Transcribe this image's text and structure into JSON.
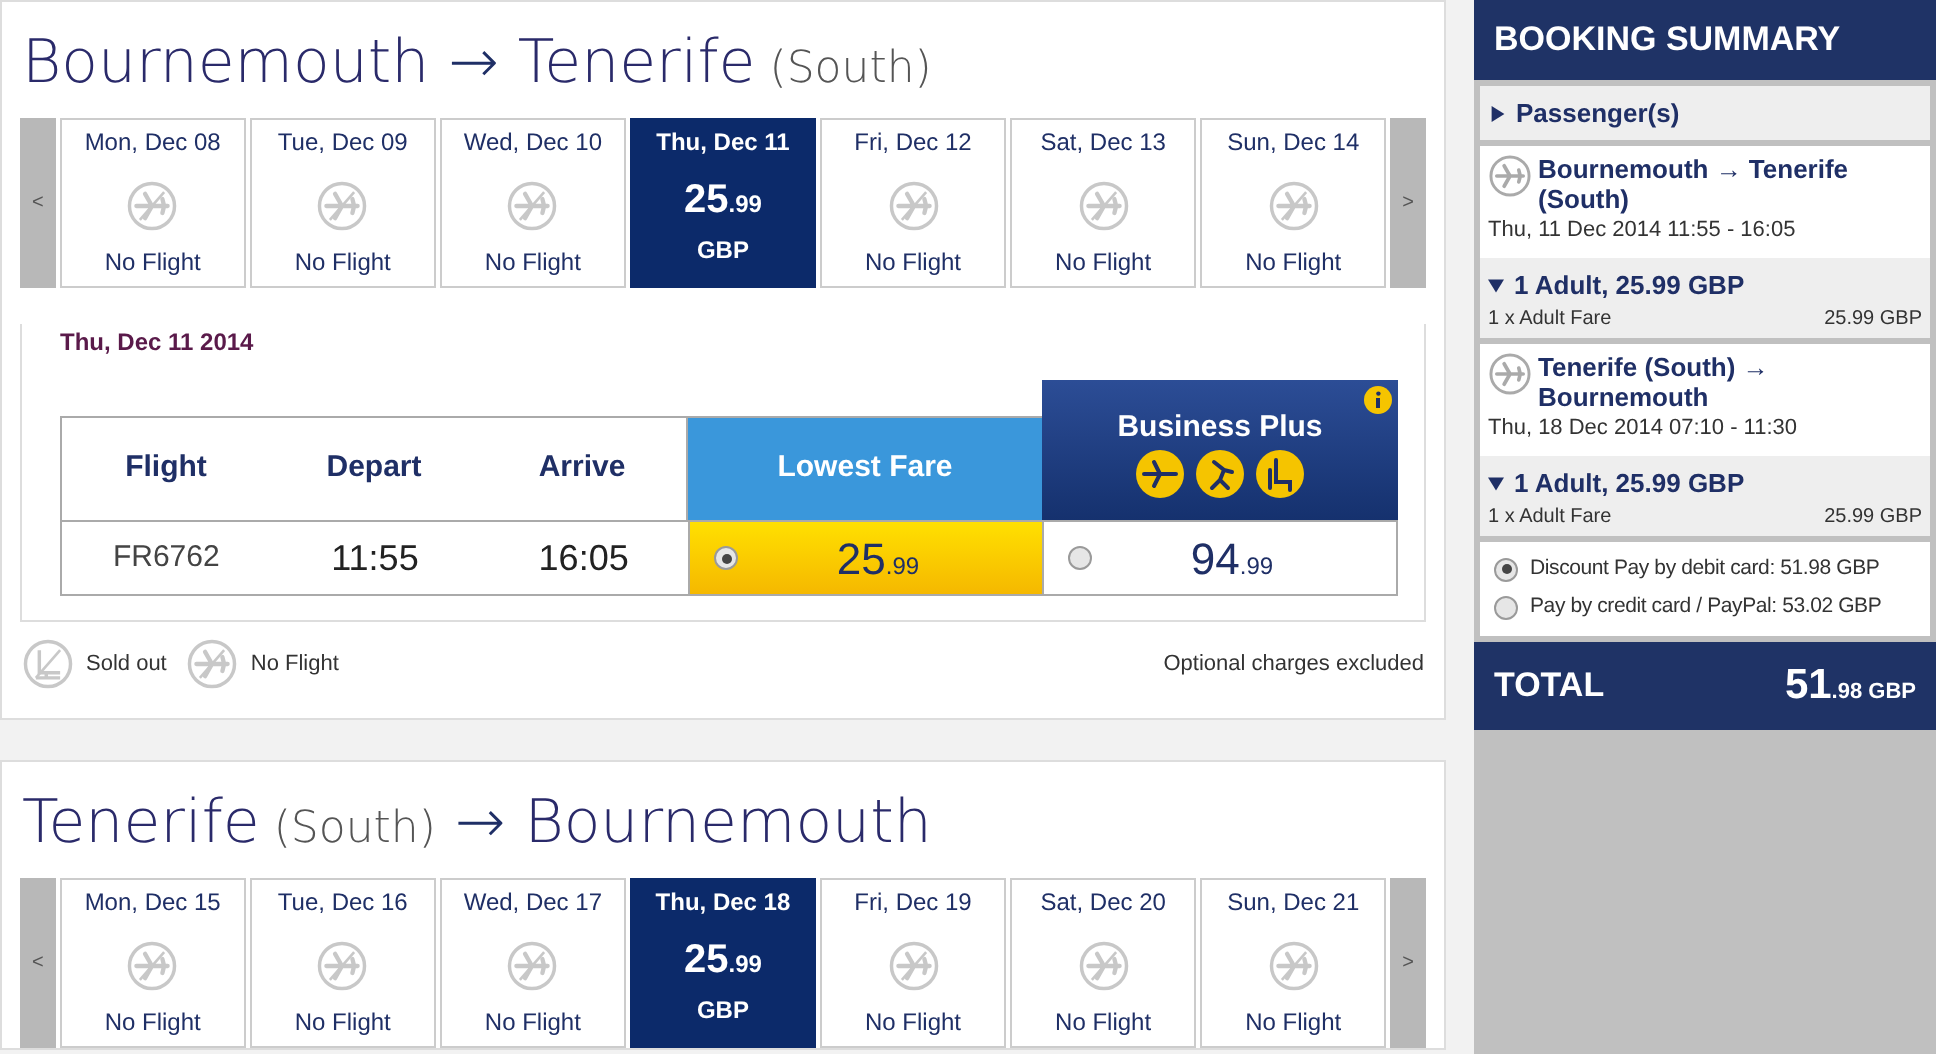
{
  "journeys": [
    {
      "title": [
        {
          "kind": "place",
          "text": "Bournemouth"
        },
        {
          "kind": "arrow",
          "text": "→"
        },
        {
          "kind": "place",
          "text": "Tenerife"
        },
        {
          "kind": "note",
          "text": "(South)"
        }
      ],
      "prev": "<",
      "next": ">",
      "days": [
        {
          "day": "Mon, Dec 08",
          "status": "No Flight",
          "selected": false
        },
        {
          "day": "Tue, Dec 09",
          "status": "No Flight",
          "selected": false
        },
        {
          "day": "Wed, Dec 10",
          "status": "No Flight",
          "selected": false
        },
        {
          "day": "Thu, Dec 11",
          "price": "25",
          "cents": ".99",
          "currency": "GBP",
          "selected": true
        },
        {
          "day": "Fri, Dec 12",
          "status": "No Flight",
          "selected": false
        },
        {
          "day": "Sat, Dec 13",
          "status": "No Flight",
          "selected": false
        },
        {
          "day": "Sun, Dec 14",
          "status": "No Flight",
          "selected": false
        }
      ],
      "date_heading": "Thu, Dec 11 2014",
      "columns": [
        "Flight",
        "Depart",
        "Arrive"
      ],
      "fares": [
        {
          "kind": "lowest",
          "label": "Lowest Fare"
        },
        {
          "kind": "business",
          "label": "Business Plus"
        }
      ],
      "flights": [
        {
          "flight": "FR6762",
          "depart": "11:55",
          "arrive": "16:05",
          "prices": [
            {
              "main": "25",
              "cents": ".99",
              "selected": true
            },
            {
              "main": "94",
              "cents": ".99",
              "selected": false
            }
          ]
        }
      ],
      "legend": [
        {
          "kind": "sold_out",
          "label": "Sold out"
        },
        {
          "kind": "no_flight",
          "label": "No Flight"
        }
      ],
      "note": "Optional charges excluded"
    },
    {
      "title": [
        {
          "kind": "place",
          "text": "Tenerife"
        },
        {
          "kind": "note",
          "text": "(South)"
        },
        {
          "kind": "arrow",
          "text": "→"
        },
        {
          "kind": "place",
          "text": "Bournemouth"
        }
      ],
      "prev": "<",
      "next": ">",
      "days": [
        {
          "day": "Mon, Dec 15",
          "status": "No Flight",
          "selected": false
        },
        {
          "day": "Tue, Dec 16",
          "status": "No Flight",
          "selected": false
        },
        {
          "day": "Wed, Dec 17",
          "status": "No Flight",
          "selected": false
        },
        {
          "day": "Thu, Dec 18",
          "price": "25",
          "cents": ".99",
          "currency": "GBP",
          "selected": true
        },
        {
          "day": "Fri, Dec 19",
          "status": "No Flight",
          "selected": false
        },
        {
          "day": "Sat, Dec 20",
          "status": "No Flight",
          "selected": false
        },
        {
          "day": "Sun, Dec 21",
          "status": "No Flight",
          "selected": false
        }
      ]
    }
  ],
  "summary": {
    "title": "BOOKING SUMMARY",
    "passengers": {
      "label": "Passenger(s)",
      "expanded": false
    },
    "legs": [
      {
        "route": "Bournemouth → Tenerife (South)",
        "times": "Thu, 11 Dec 2014 11:55 - 16:05",
        "fare_heading": "1 Adult, 25.99 GBP",
        "expanded": true,
        "fare_line": "1 x Adult Fare",
        "fare_amount": "25.99 GBP"
      },
      {
        "route": "Tenerife (South) → Bournemouth",
        "times": "Thu, 18 Dec 2014 07:10 - 11:30",
        "fare_heading": "1 Adult, 25.99 GBP",
        "expanded": true,
        "fare_line": "1 x Adult Fare",
        "fare_amount": "25.99 GBP"
      }
    ],
    "payment": [
      {
        "label": "Discount Pay by debit card: 51.98 GBP",
        "selected": true
      },
      {
        "label": "Pay by credit card / PayPal: 53.02 GBP",
        "selected": false
      }
    ],
    "total_label": "TOTAL",
    "total_main": "51",
    "total_cents": ".98",
    "total_currency": "GBP"
  }
}
